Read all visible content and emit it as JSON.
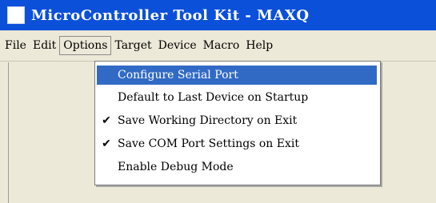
{
  "window": {
    "title": "MicroController Tool Kit - MAXQ"
  },
  "menubar": {
    "items": [
      {
        "label": "File"
      },
      {
        "label": "Edit"
      },
      {
        "label": "Options"
      },
      {
        "label": "Target"
      },
      {
        "label": "Device"
      },
      {
        "label": "Macro"
      },
      {
        "label": "Help"
      }
    ]
  },
  "options_menu": {
    "items": [
      {
        "label": "Configure Serial Port",
        "checked": false,
        "highlighted": true
      },
      {
        "label": "Default to Last Device on Startup",
        "checked": false,
        "highlighted": false
      },
      {
        "label": "Save Working Directory on Exit",
        "checked": true,
        "highlighted": false
      },
      {
        "label": "Save COM Port Settings on Exit",
        "checked": true,
        "highlighted": false
      },
      {
        "label": "Enable Debug Mode",
        "checked": false,
        "highlighted": false
      }
    ],
    "check_glyph": "✔"
  },
  "colors": {
    "titlebar": "#0b50d9",
    "highlight": "#316ac5",
    "menubar": "#ece9d8"
  },
  "icons": {
    "app": "app-icon",
    "check": "check-icon"
  }
}
